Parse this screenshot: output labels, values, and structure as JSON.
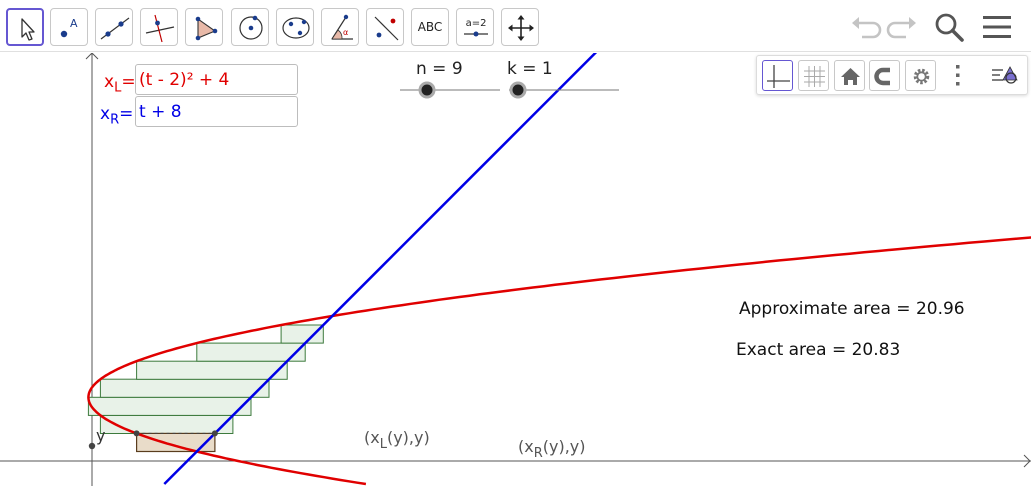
{
  "toolbar": {
    "tools": [
      {
        "name": "move-tool",
        "icon": "pointer-arrow-icon"
      },
      {
        "name": "point-tool",
        "icon": "point-icon",
        "label": "A"
      },
      {
        "name": "line-tool",
        "icon": "line-through-points-icon"
      },
      {
        "name": "perpendicular-line-tool",
        "icon": "perpendicular-line-icon"
      },
      {
        "name": "polygon-tool",
        "icon": "polygon-icon"
      },
      {
        "name": "circle-tool",
        "icon": "circle-with-center-icon"
      },
      {
        "name": "conic-tool",
        "icon": "ellipse-icon"
      },
      {
        "name": "angle-tool",
        "icon": "angle-icon",
        "label": "α"
      },
      {
        "name": "reflect-tool",
        "icon": "reflect-about-line-icon"
      },
      {
        "name": "text-tool",
        "icon": "text-icon",
        "label": "ABC"
      },
      {
        "name": "slider-tool",
        "icon": "slider-icon",
        "label": "a=2"
      },
      {
        "name": "move-graphics-tool",
        "icon": "move-cross-arrows-icon"
      }
    ],
    "right": [
      "undo-icon",
      "redo-icon",
      "search-icon",
      "menu-icon"
    ]
  },
  "style_bar": [
    "axes-icon",
    "grid-icon",
    "home-icon",
    "magnet-icon",
    "gear-icon",
    "more-vertical-icon",
    "graphics-style-icon"
  ],
  "inputs": {
    "xl": {
      "label_main": "x",
      "label_sub": "L",
      "label_eq": "=",
      "expression": "(t - 2)² + 4"
    },
    "xr": {
      "label_main": "x",
      "label_sub": "R",
      "label_eq": "=",
      "expression": "t + 8"
    }
  },
  "sliders": {
    "n": {
      "label": "n = 9",
      "value": 9
    },
    "k": {
      "label": "k = 1",
      "value": 1
    }
  },
  "texts": {
    "approx": "Approximate area = 20.96",
    "exact": "Exact area = 20.83"
  },
  "labels": {
    "y_axis": "y",
    "left_point": {
      "main": "(x",
      "sub": "L",
      "rest": "(y),y)"
    },
    "right_point": {
      "main": "(x",
      "sub": "R",
      "rest": "(y),y)"
    }
  },
  "colors": {
    "accent": "#6557d2",
    "red_curve": "#e00000",
    "blue_line": "#0000e6",
    "rect_fill": "#e8f2e8",
    "rect_stroke": "#3c7a3c",
    "highlight_fill": "#e9dcc9",
    "highlight_stroke": "#5a3d1e"
  }
}
